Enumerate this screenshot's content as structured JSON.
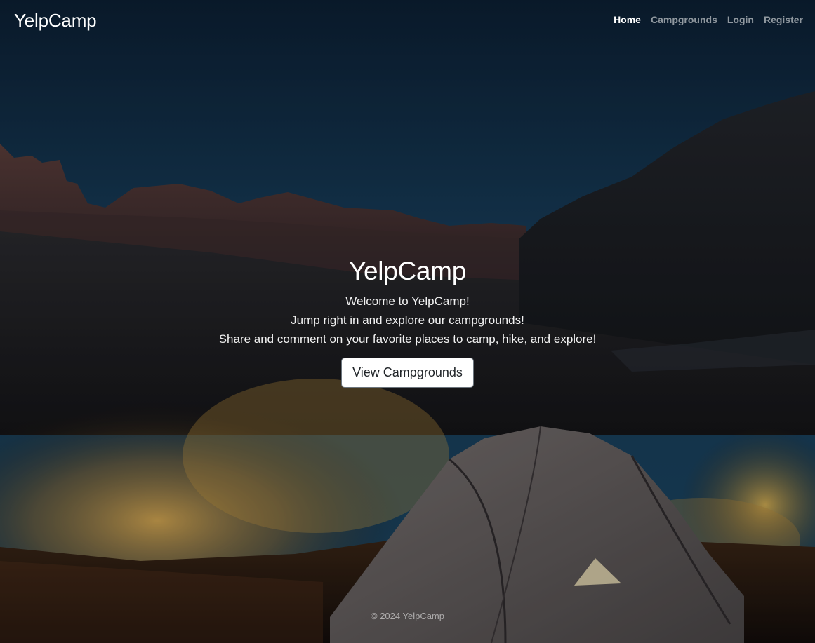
{
  "navbar": {
    "brand": "YelpCamp",
    "links": [
      {
        "label": "Home",
        "active": true
      },
      {
        "label": "Campgrounds",
        "active": false
      },
      {
        "label": "Login",
        "active": false
      },
      {
        "label": "Register",
        "active": false
      }
    ]
  },
  "hero": {
    "title": "YelpCamp",
    "lines": [
      "Welcome to YelpCamp!",
      "Jump right in and explore our campgrounds!",
      "Share and comment on your favorite places to camp, hike, and explore!"
    ],
    "button_label": "View Campgrounds"
  },
  "footer": {
    "text": "© 2024 YelpCamp"
  },
  "colors": {
    "sky_top": "#0f2740",
    "sky_bottom": "#173d5a",
    "cliffs": "#4a3433",
    "dark_ridge": "#1c1f24",
    "grass_glow": "#c9a04a",
    "ground": "#3a2418",
    "tent": "#6b6668",
    "button_bg": "#ffffff"
  },
  "background_image": {
    "subject": "tent-in-desert-canyon-at-dusk"
  }
}
